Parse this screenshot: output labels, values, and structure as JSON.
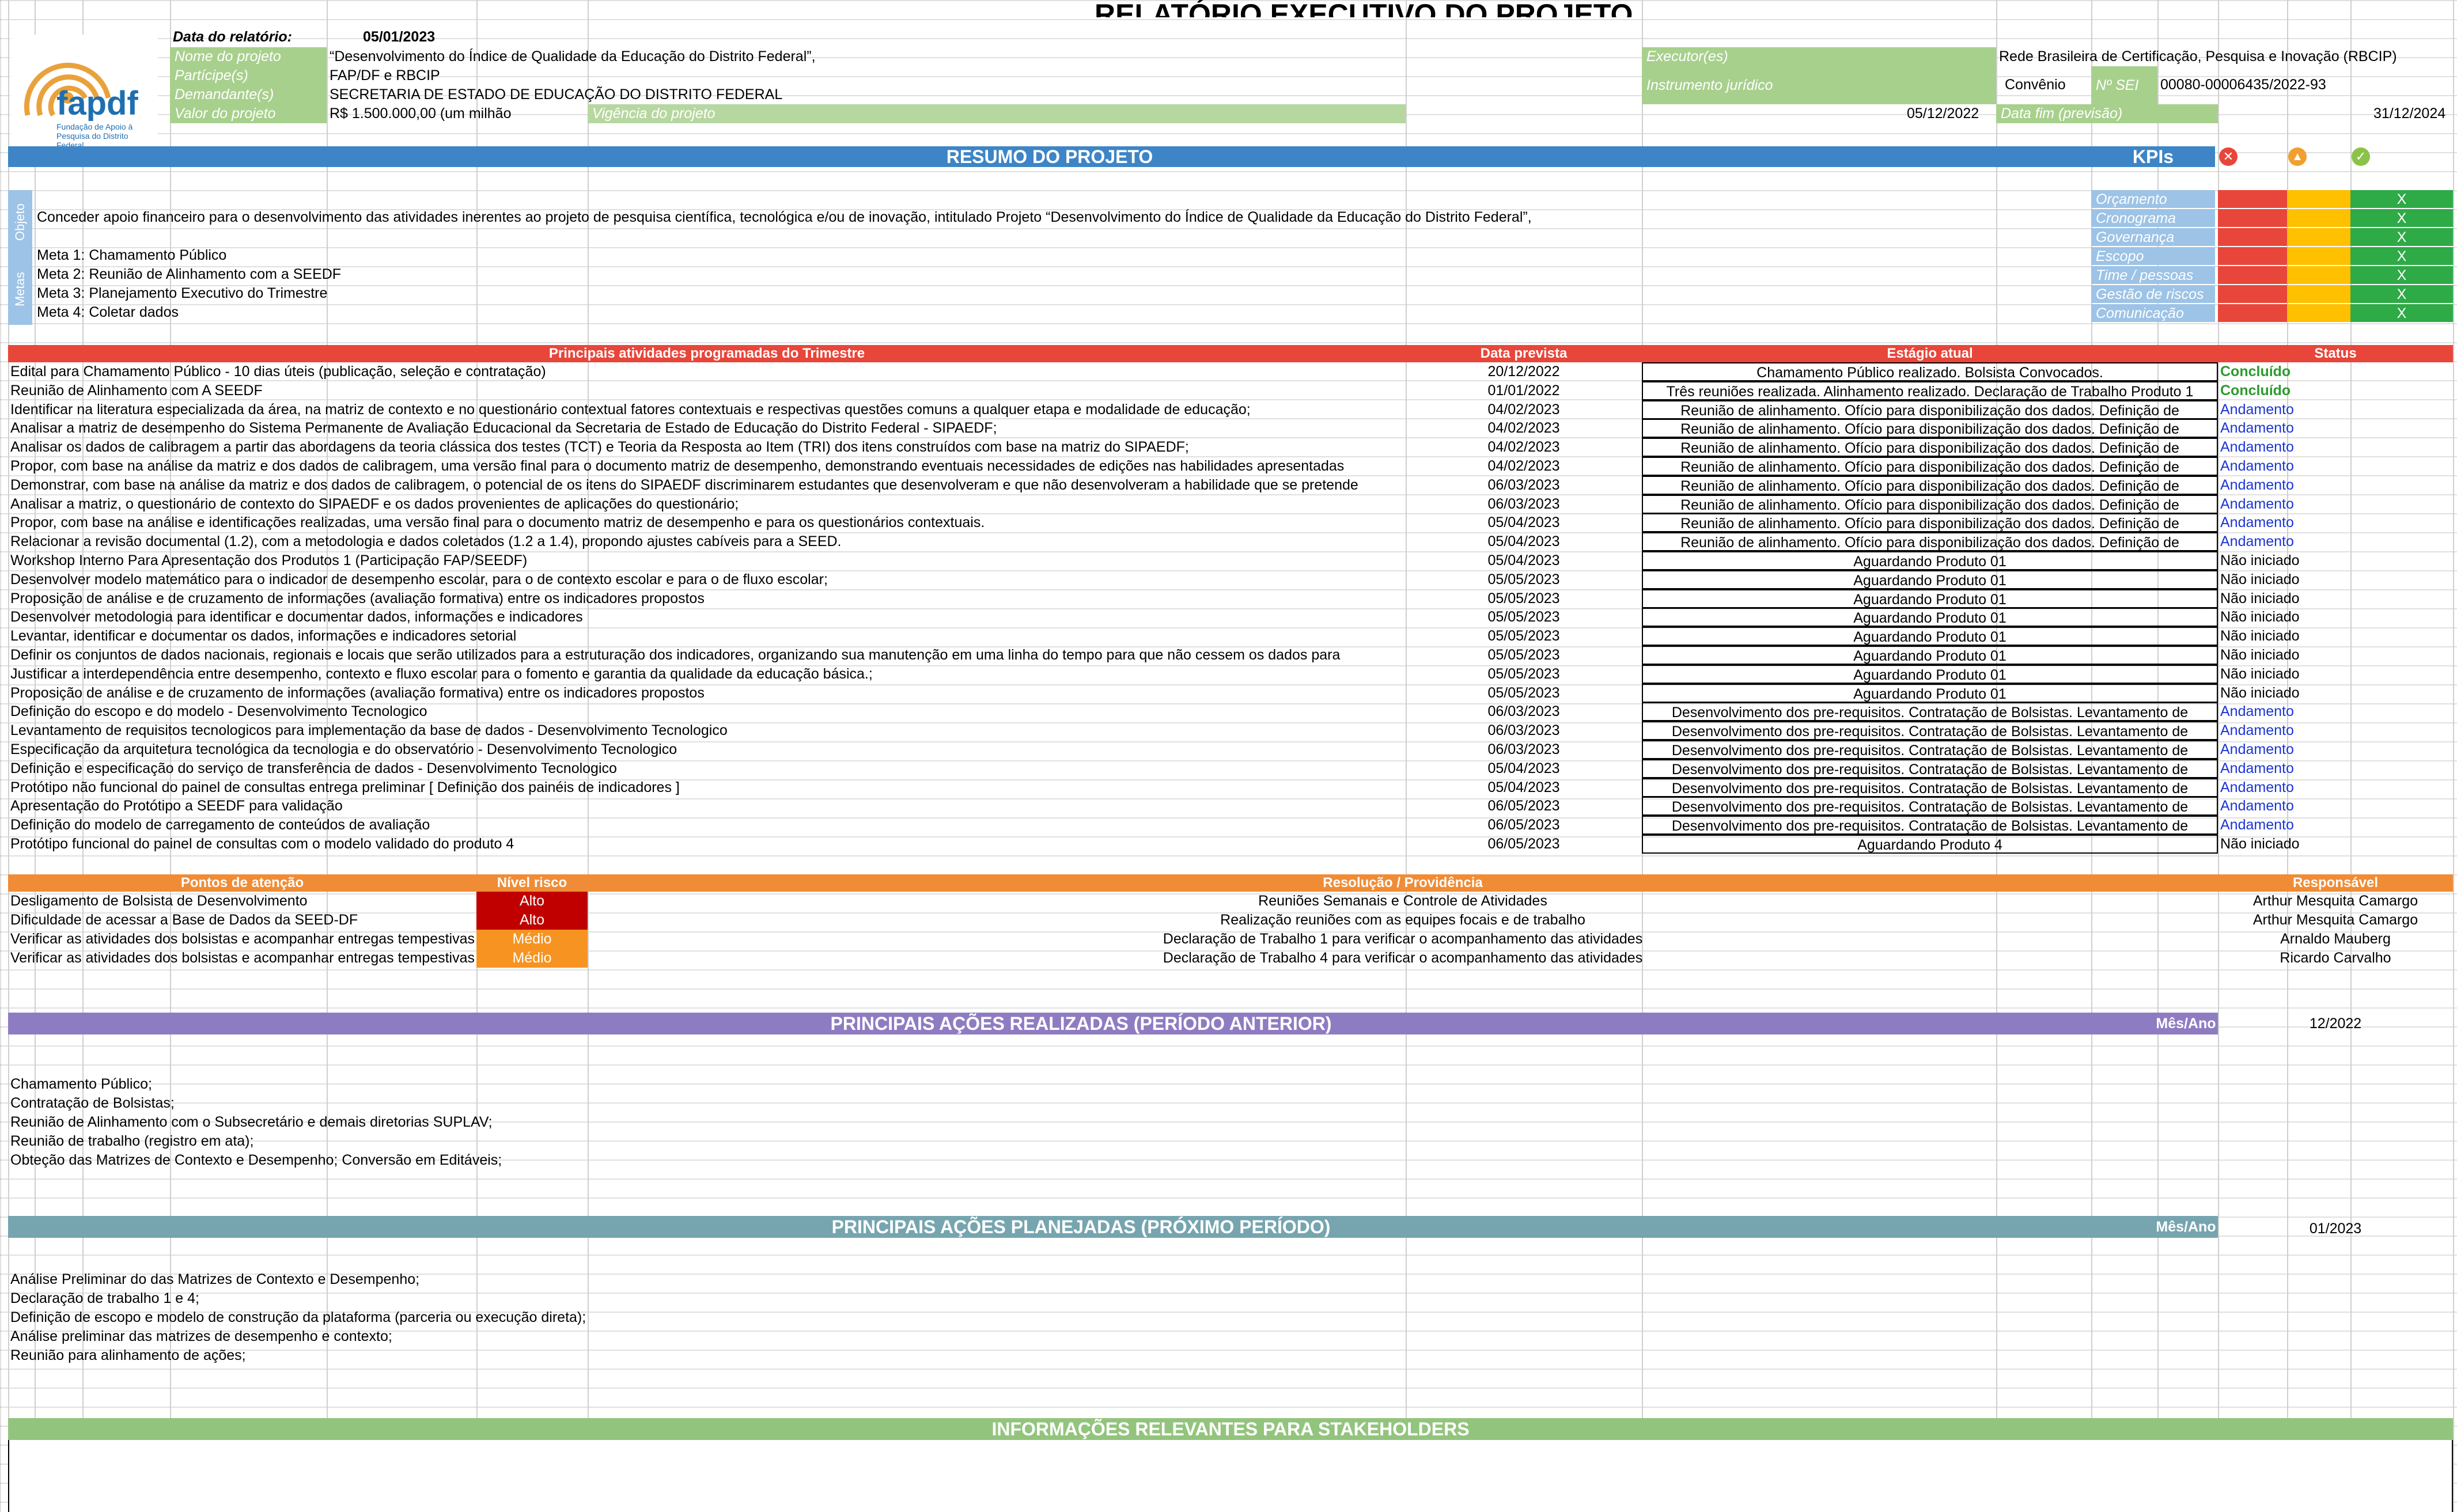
{
  "header": {
    "title": "RELATÓRIO EXECUTIVO DO PROJETO",
    "report_date_label": "Data do relatório:",
    "report_date": "05/01/2023",
    "logo_text": "fapdf",
    "logo_subtext": "Fundação de Apoio à Pesquisa do Distrito Federal",
    "fields": {
      "nome_label": "Nome do projeto",
      "nome_value": "“Desenvolvimento do Índice de Qualidade da Educação do Distrito Federal”,",
      "partic_label": "Partícipe(s)",
      "partic_value": "FAP/DF e RBCIP",
      "demand_label": "Demandante(s)",
      "demand_value": "SECRETARIA DE ESTADO DE EDUCAÇÃO DO DISTRITO FEDERAL",
      "valor_label": "Valor do projeto",
      "valor_value": "R$ 1.500.000,00 (um milhão",
      "vigencia_label": "Vigência do projeto",
      "vigencia_value": "05/12/2022",
      "executor_label": "Executor(es)",
      "executor_value": "Rede Brasileira de Certificação, Pesquisa e Inovação (RBCIP)",
      "instrumento_label": "Instrumento jurídico",
      "instrumento_value": "Convênio",
      "sei_label": "Nº SEI",
      "sei_value": "00080-00006435/2022-93",
      "datafim_label": "Data fim (previsão)",
      "datafim_value": "31/12/2024"
    }
  },
  "resumo": {
    "band": "RESUMO DO PROJETO",
    "kpis_title": "KPIs",
    "objetivo_label": "Objeto",
    "objetivo_text": "Conceder apoio financeiro para o desenvolvimento das atividades inerentes ao projeto de pesquisa científica, tecnológica e/ou de inovação, intitulado Projeto “Desenvolvimento do Índice de Qualidade da Educação do Distrito Federal”,",
    "metas_label": "Metas",
    "metas": [
      "Meta 1: Chamamento Público",
      "Meta 2: Reunião de Alinhamento com a SEEDF",
      "Meta 3: Planejamento Executivo do Trimestre",
      "Meta 4: Coletar dados"
    ],
    "kpis": [
      {
        "label": "Orçamento",
        "mark": "X"
      },
      {
        "label": "Cronograma",
        "mark": "X"
      },
      {
        "label": "Governança",
        "mark": "X"
      },
      {
        "label": "Escopo",
        "mark": "X"
      },
      {
        "label": "Time / pessoas",
        "mark": "X"
      },
      {
        "label": "Gestão de riscos",
        "mark": "X"
      },
      {
        "label": "Comunicação",
        "mark": "X"
      }
    ],
    "kpi_icons": [
      "x-circle-icon",
      "warning-circle-icon",
      "check-circle-icon"
    ]
  },
  "atividades": {
    "col_atividade": "Principais atividades programadas do Trimestre",
    "col_data": "Data prevista",
    "col_estagio": "Estágio atual",
    "col_status": "Status",
    "rows": [
      {
        "a": "Edital para Chamamento Público - 10 dias úteis (publicação, seleção e contratação)",
        "d": "20/12/2022",
        "e": "Chamamento Público realizado. Bolsista Convocados.",
        "s": "Concluído",
        "c": "green"
      },
      {
        "a": "Reunião de Alinhamento com A SEEDF",
        "d": "01/01/2022",
        "e": "Três reuniões realizada. Alinhamento realizado. Declaração de Trabalho Produto 1",
        "s": "Concluído",
        "c": "green"
      },
      {
        "a": "Identificar na literatura especializada da área, na matriz de contexto e no questionário contextual fatores contextuais e respectivas questões comuns a qualquer etapa e modalidade de educação;",
        "d": "04/02/2023",
        "e": "Reunião de alinhamento. Ofício para disponibilização dos dados. Definição de",
        "s": "Andamento",
        "c": "blue"
      },
      {
        "a": "Analisar a matriz de desempenho do Sistema Permanente de Avaliação Educacional da Secretaria de Estado de Educação do Distrito Federal - SIPAEDF;",
        "d": "04/02/2023",
        "e": "Reunião de alinhamento. Ofício para disponibilização dos dados. Definição de",
        "s": "Andamento",
        "c": "blue"
      },
      {
        "a": "Analisar os dados de calibragem a partir das abordagens da teoria clássica dos testes (TCT) e Teoria da Resposta ao Item (TRI) dos itens construídos com base na matriz do SIPAEDF;",
        "d": "04/02/2023",
        "e": "Reunião de alinhamento. Ofício para disponibilização dos dados. Definição de",
        "s": "Andamento",
        "c": "blue"
      },
      {
        "a": "Propor, com base na análise da matriz e dos dados de calibragem, uma versão final para o documento matriz de desempenho, demonstrando eventuais necessidades de edições nas habilidades apresentadas",
        "d": "04/02/2023",
        "e": "Reunião de alinhamento. Ofício para disponibilização dos dados. Definição de",
        "s": "Andamento",
        "c": "blue"
      },
      {
        "a": "Demonstrar, com base na análise da matriz e dos dados de calibragem, o potencial de os itens do SIPAEDF discriminarem estudantes que desenvolveram e que não desenvolveram a habilidade que se pretende",
        "d": "06/03/2023",
        "e": "Reunião de alinhamento. Ofício para disponibilização dos dados. Definição de",
        "s": "Andamento",
        "c": "blue"
      },
      {
        "a": "Analisar a matriz, o questionário de contexto do SIPAEDF e os dados provenientes de aplicações do questionário;",
        "d": "06/03/2023",
        "e": "Reunião de alinhamento. Ofício para disponibilização dos dados. Definição de",
        "s": "Andamento",
        "c": "blue"
      },
      {
        "a": "Propor, com base na análise e identificações realizadas, uma versão final para o documento matriz de desempenho e para os questionários contextuais.",
        "d": "05/04/2023",
        "e": "Reunião de alinhamento. Ofício para disponibilização dos dados. Definição de",
        "s": "Andamento",
        "c": "blue"
      },
      {
        "a": "Relacionar a revisão documental (1.2), com a metodologia e dados coletados (1.2 a 1.4), propondo ajustes cabíveis para a SEED.",
        "d": "05/04/2023",
        "e": "Reunião de alinhamento. Ofício para disponibilização dos dados. Definição de",
        "s": "Andamento",
        "c": "blue"
      },
      {
        "a": "Workshop Interno Para Apresentação dos Produtos 1 (Participação FAP/SEEDF)",
        "d": "05/04/2023",
        "e": "Aguardando Produto 01",
        "s": "Não iniciado",
        "c": "black"
      },
      {
        "a": "Desenvolver modelo matemático para o indicador de desempenho escolar, para o de contexto escolar e para o de fluxo escolar;",
        "d": "05/05/2023",
        "e": "Aguardando Produto 01",
        "s": "Não iniciado",
        "c": "black"
      },
      {
        "a": "Proposição de análise e de cruzamento de informações (avaliação formativa) entre os indicadores propostos",
        "d": "05/05/2023",
        "e": "Aguardando Produto 01",
        "s": "Não iniciado",
        "c": "black"
      },
      {
        "a": "Desenvolver metodologia para identificar e documentar dados, informações e indicadores",
        "d": "05/05/2023",
        "e": "Aguardando Produto 01",
        "s": "Não iniciado",
        "c": "black"
      },
      {
        "a": "Levantar, identificar e documentar os dados, informações e indicadores setorial",
        "d": "05/05/2023",
        "e": "Aguardando Produto 01",
        "s": "Não iniciado",
        "c": "black"
      },
      {
        "a": "Definir os conjuntos de dados nacionais, regionais e locais que serão utilizados para a estruturação dos indicadores, organizando sua manutenção em uma linha do tempo para que não cessem os dados para",
        "d": "05/05/2023",
        "e": "Aguardando Produto 01",
        "s": "Não iniciado",
        "c": "black"
      },
      {
        "a": "Justificar a interdependência entre desempenho, contexto e fluxo escolar para o fomento e garantia da qualidade da educação básica.;",
        "d": "05/05/2023",
        "e": "Aguardando Produto 01",
        "s": "Não iniciado",
        "c": "black"
      },
      {
        "a": "Proposição de análise e de cruzamento de informações (avaliação formativa) entre os indicadores propostos",
        "d": "05/05/2023",
        "e": "Aguardando Produto 01",
        "s": "Não iniciado",
        "c": "black"
      },
      {
        "a": "Definição do escopo e do modelo - Desenvolvimento Tecnologico",
        "d": "06/03/2023",
        "e": "Desenvolvimento dos pre-requisitos. Contratação de Bolsistas. Levantamento de",
        "s": "Andamento",
        "c": "blue"
      },
      {
        "a": "Levantamento de requisitos tecnologicos para implementação da base de dados  - Desenvolvimento Tecnologico",
        "d": "06/03/2023",
        "e": "Desenvolvimento dos pre-requisitos. Contratação de Bolsistas. Levantamento de",
        "s": "Andamento",
        "c": "blue"
      },
      {
        "a": "Especificação da arquitetura tecnológica da tecnologia e do observatório  - Desenvolvimento Tecnologico",
        "d": "06/03/2023",
        "e": "Desenvolvimento dos pre-requisitos. Contratação de Bolsistas. Levantamento de",
        "s": "Andamento",
        "c": "blue"
      },
      {
        "a": "Definição e especificação do serviço de transferência de dados  - Desenvolvimento Tecnologico",
        "d": "05/04/2023",
        "e": "Desenvolvimento dos pre-requisitos. Contratação de Bolsistas. Levantamento de",
        "s": "Andamento",
        "c": "blue"
      },
      {
        "a": "Protótipo não funcional do painel de consultas entrega preliminar [ Definição dos painéis de indicadores ]",
        "d": "05/04/2023",
        "e": "Desenvolvimento dos pre-requisitos. Contratação de Bolsistas. Levantamento de",
        "s": "Andamento",
        "c": "blue"
      },
      {
        "a": "Apresentação do Protótipo a SEEDF para validação",
        "d": "06/05/2023",
        "e": "Desenvolvimento dos pre-requisitos. Contratação de Bolsistas. Levantamento de",
        "s": "Andamento",
        "c": "blue"
      },
      {
        "a": "Definição do modelo de carregamento de conteúdos de avaliação",
        "d": "06/05/2023",
        "e": "Desenvolvimento dos pre-requisitos. Contratação de Bolsistas. Levantamento de",
        "s": "Andamento",
        "c": "blue"
      },
      {
        "a": "Protótipo funcional do painel de consultas com o modelo validado do produto 4",
        "d": "06/05/2023",
        "e": "Aguardando Produto 4",
        "s": "Não iniciado",
        "c": "black"
      }
    ]
  },
  "riscos": {
    "col_ponto": "Pontos de atenção",
    "col_nivel": "Nível risco",
    "col_resolucao": "Resolução / Providência",
    "col_resp": "Responsável",
    "rows": [
      {
        "p": "Desligamento de Bolsista de Desenvolvimento",
        "n": "Alto",
        "r": "Reuniões Semanais e Controle de Atividades",
        "resp": "Arthur Mesquita Camargo",
        "lvl": "high"
      },
      {
        "p": "Dificuldade de acessar a Base de Dados da SEED-DF",
        "n": "Alto",
        "r": "Realização reuniões com as equipes focais e de trabalho",
        "resp": "Arthur Mesquita Camargo",
        "lvl": "high"
      },
      {
        "p": "Verificar as atividades dos bolsistas e acompanhar entregas tempestivas",
        "n": "Médio",
        "r": "Declaração de Trabalho 1 para verificar o acompanhamento das atividades",
        "resp": "Arnaldo Mauberg",
        "lvl": "mid"
      },
      {
        "p": "Verificar as atividades dos bolsistas e acompanhar entregas tempestivas",
        "n": "Médio",
        "r": "Declaração de Trabalho 4 para verificar o acompanhamento das atividades",
        "resp": "Ricardo Carvalho",
        "lvl": "mid"
      }
    ]
  },
  "realizadas": {
    "band": "PRINCIPAIS AÇÕES REALIZADAS (PERÍODO ANTERIOR)",
    "mesano_label": "Mês/Ano",
    "mesano_value": "12/2022",
    "items": [
      "Chamamento Público;",
      "Contratação de Bolsistas;",
      "Reunião de Alinhamento com o Subsecretário e demais diretorias SUPLAV;",
      "Reunião de trabalho (registro em ata);",
      "Obteção das Matrizes de Contexto e Desempenho; Conversão em Editáveis;"
    ]
  },
  "planejadas": {
    "band": "PRINCIPAIS AÇÕES PLANEJADAS (PRÓXIMO PERÍODO)",
    "mesano_label": "Mês/Ano",
    "mesano_value": "01/2023",
    "items": [
      "Análise Preliminar do das Matrizes de Contexto e Desempenho;",
      "Declaração de trabalho 1 e 4;",
      "Definição de escopo e modelo de construção da plataforma (parceria ou execução direta);",
      "Análise preliminar das matrizes de desempenho e contexto;",
      "Reunião para alinhamento de ações;"
    ]
  },
  "stakeholders": {
    "band": "INFORMAÇÕES RELEVANTES PARA STAKEHOLDERS"
  },
  "colors": {
    "blue_band": "#3d85c6",
    "red_header": "#e8463a",
    "orange_header": "#f08c35",
    "purple_band": "#8e7cc3",
    "teal_band": "#76a5af",
    "green_band": "#93c47d",
    "label_green": "#a8d08d"
  }
}
